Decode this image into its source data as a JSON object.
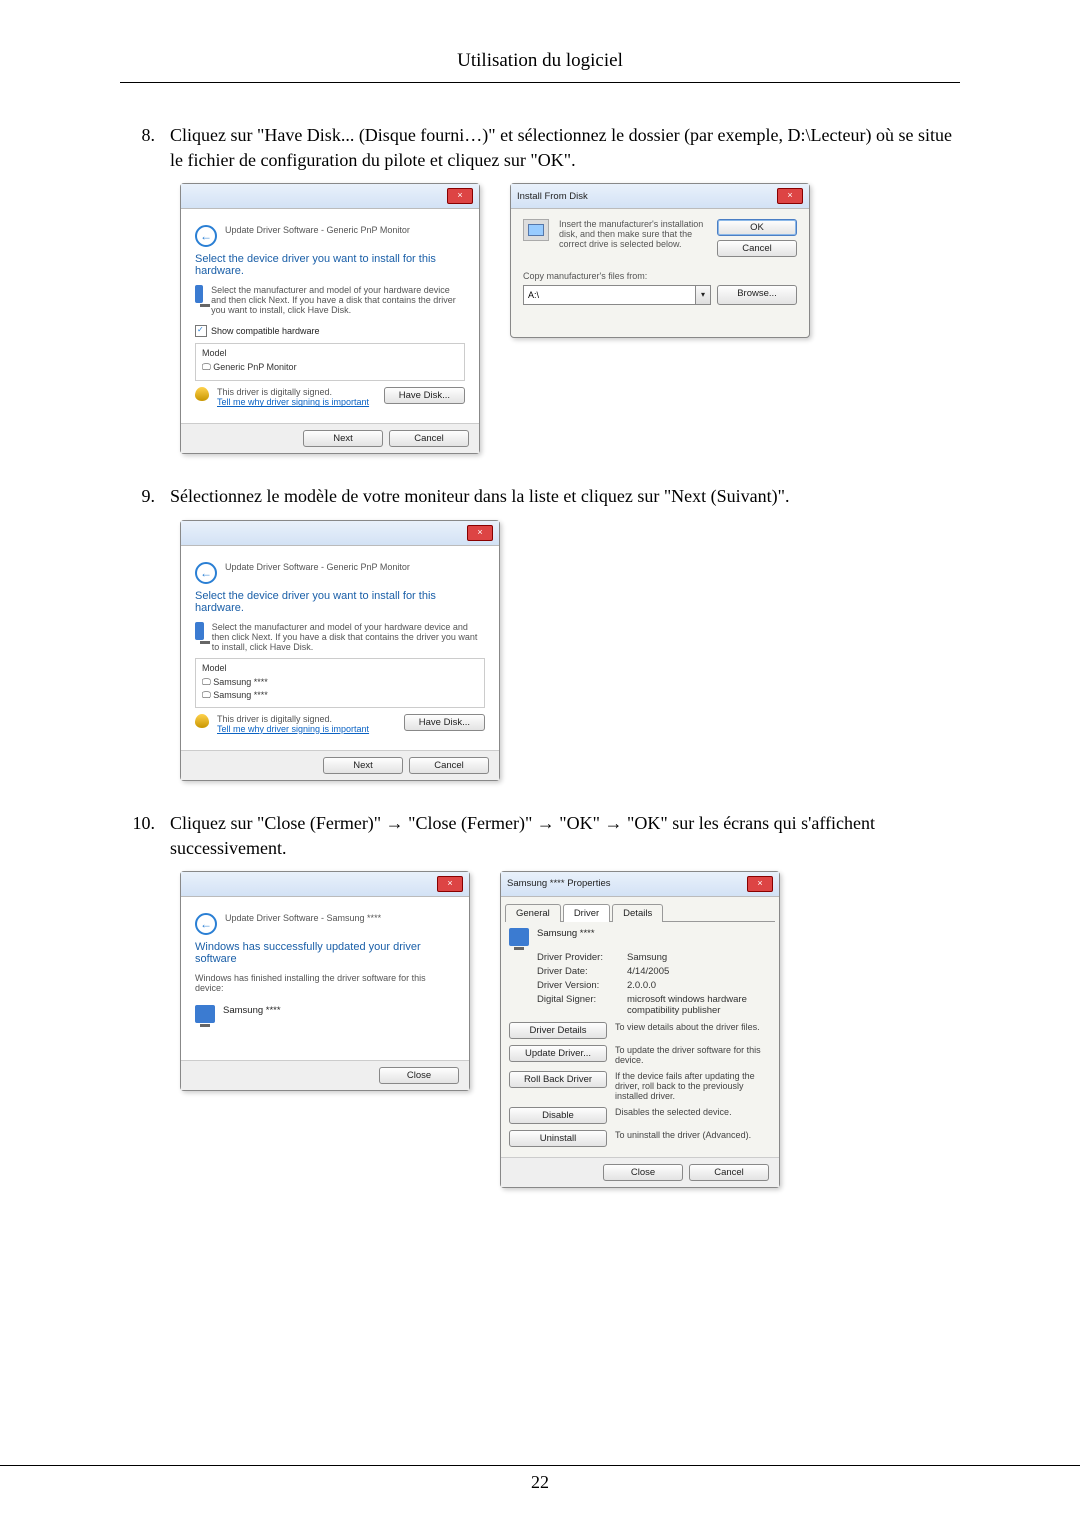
{
  "header": {
    "title": "Utilisation du logiciel"
  },
  "page_number": "22",
  "steps": {
    "s8": {
      "num": "8.",
      "text": "Cliquez sur \"Have Disk... (Disque fourni…)\" et sélectionnez le dossier (par exemple, D:\\Lecteur) où se situe le fichier de configuration du pilote et cliquez sur \"OK\"."
    },
    "s9": {
      "num": "9.",
      "text": "Sélectionnez le modèle de votre moniteur dans la liste et cliquez sur \"Next (Suivant)\"."
    },
    "s10": {
      "num": "10.",
      "text": "Cliquez sur \"Close (Fermer)\" → \"Close (Fermer)\" → \"OK\" → \"OK\" sur les écrans qui s'affichent successivement."
    }
  },
  "dlg_update1": {
    "breadcrumb": "Update Driver Software - Generic PnP Monitor",
    "heading": "Select the device driver you want to install for this hardware.",
    "note": "Select the manufacturer and model of your hardware device and then click Next. If you have a disk that contains the driver you want to install, click Have Disk.",
    "show_compat": "Show compatible hardware",
    "model_hd": "Model",
    "model_item": "Generic PnP Monitor",
    "signed": "This driver is digitally signed.",
    "why_link": "Tell me why driver signing is important",
    "have_disk": "Have Disk...",
    "next": "Next",
    "cancel": "Cancel"
  },
  "dlg_install": {
    "title": "Install From Disk",
    "msg": "Insert the manufacturer's installation disk, and then make sure that the correct drive is selected below.",
    "copy_from": "Copy manufacturer's files from:",
    "path": "A:\\",
    "ok": "OK",
    "cancel": "Cancel",
    "browse": "Browse..."
  },
  "dlg_update2": {
    "breadcrumb": "Update Driver Software - Generic PnP Monitor",
    "heading": "Select the device driver you want to install for this hardware.",
    "note": "Select the manufacturer and model of your hardware device and then click Next. If you have a disk that contains the driver you want to install, click Have Disk.",
    "model_hd": "Model",
    "model_item1": "Samsung ****",
    "model_item2": "Samsung ****",
    "signed": "This driver is digitally signed.",
    "why_link": "Tell me why driver signing is important",
    "have_disk": "Have Disk...",
    "next": "Next",
    "cancel": "Cancel"
  },
  "dlg_done": {
    "breadcrumb": "Update Driver Software - Samsung ****",
    "heading": "Windows has successfully updated your driver software",
    "line": "Windows has finished installing the driver software for this device:",
    "device": "Samsung ****",
    "close": "Close"
  },
  "dlg_props": {
    "title": "Samsung **** Properties",
    "tabs": {
      "general": "General",
      "driver": "Driver",
      "details": "Details"
    },
    "device": "Samsung ****",
    "rows": {
      "provider_k": "Driver Provider:",
      "provider_v": "Samsung",
      "date_k": "Driver Date:",
      "date_v": "4/14/2005",
      "version_k": "Driver Version:",
      "version_v": "2.0.0.0",
      "signer_k": "Digital Signer:",
      "signer_v": "microsoft windows hardware compatibility publisher"
    },
    "btns": {
      "details": "Driver Details",
      "details_d": "To view details about the driver files.",
      "update": "Update Driver...",
      "update_d": "To update the driver software for this device.",
      "rollback": "Roll Back Driver",
      "rollback_d": "If the device fails after updating the driver, roll back to the previously installed driver.",
      "disable": "Disable",
      "disable_d": "Disables the selected device.",
      "uninstall": "Uninstall",
      "uninstall_d": "To uninstall the driver (Advanced)."
    },
    "close": "Close",
    "cancel": "Cancel"
  }
}
